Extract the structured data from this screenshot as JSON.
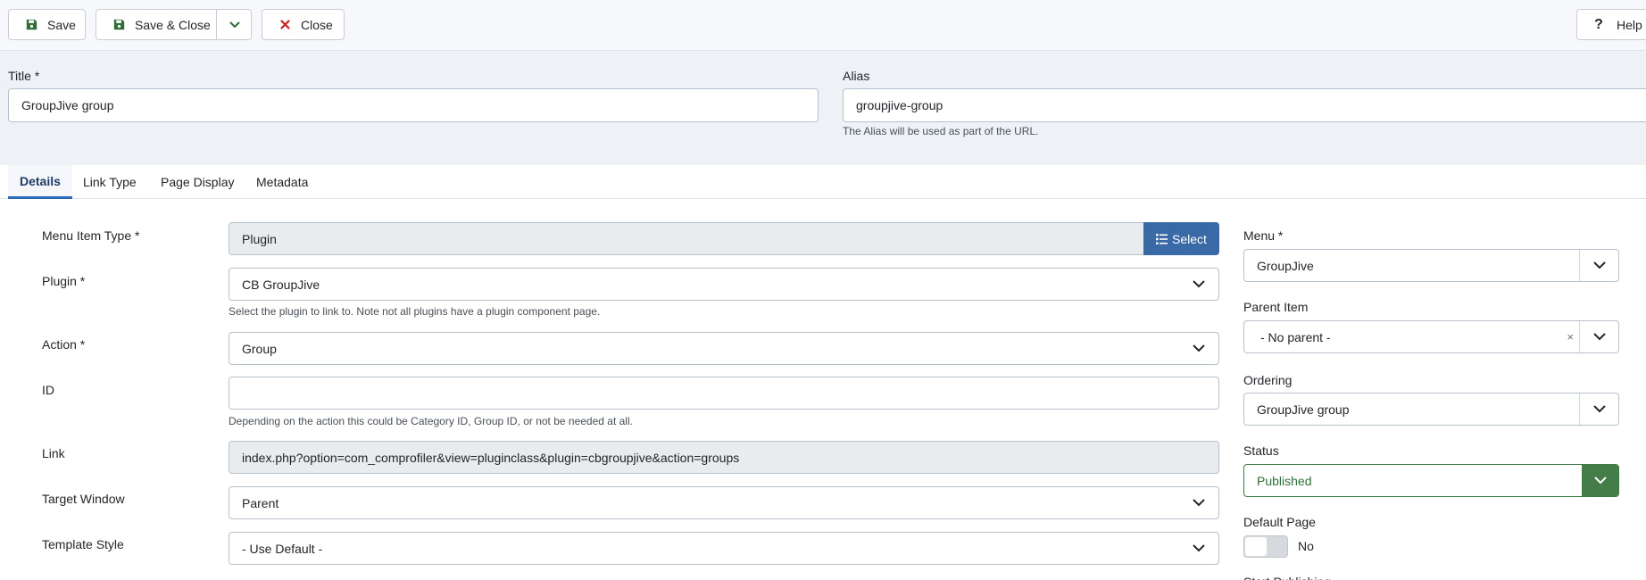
{
  "toolbar": {
    "save_label": "Save",
    "save_close_label": "Save & Close",
    "close_label": "Close",
    "help_label": "Help",
    "icons": {
      "save": "save-icon",
      "dropdown": "chevron-down-icon",
      "close": "close-icon",
      "help": "question-icon"
    },
    "colors": {
      "save_icon": "#2f6e37",
      "close_icon": "#c52827"
    }
  },
  "title": {
    "label": "Title *",
    "value": "GroupJive group"
  },
  "alias": {
    "label": "Alias",
    "value": "groupjive-group",
    "hint": "The Alias will be used as part of the URL."
  },
  "tabs": [
    {
      "label": "Details",
      "active": true
    },
    {
      "label": "Link Type",
      "active": false
    },
    {
      "label": "Page Display",
      "active": false
    },
    {
      "label": "Metadata",
      "active": false
    }
  ],
  "details": {
    "menu_item_type": {
      "label": "Menu Item Type *",
      "value": "Plugin",
      "button_label": "Select"
    },
    "plugin": {
      "label": "Plugin *",
      "value": "CB GroupJive",
      "hint": "Select the plugin to link to. Note not all plugins have a plugin component page."
    },
    "action": {
      "label": "Action *",
      "value": "Group"
    },
    "id": {
      "label": "ID",
      "value": "",
      "hint": "Depending on the action this could be Category ID, Group ID, or not be needed at all."
    },
    "link": {
      "label": "Link",
      "value": "index.php?option=com_comprofiler&view=pluginclass&plugin=cbgroupjive&action=groups"
    },
    "target_window": {
      "label": "Target Window",
      "value": "Parent"
    },
    "template_style": {
      "label": "Template Style",
      "value": "- Use Default -"
    }
  },
  "sidebar": {
    "menu": {
      "label": "Menu *",
      "value": "GroupJive"
    },
    "parent_item": {
      "label": "Parent Item",
      "value": "- No parent -",
      "clear": "×"
    },
    "ordering": {
      "label": "Ordering",
      "value": "GroupJive group"
    },
    "status": {
      "label": "Status",
      "value": "Published",
      "color": "#457d49"
    },
    "default_page": {
      "label": "Default Page",
      "value": "No"
    },
    "start_publishing": {
      "label": "Start Publishing"
    }
  }
}
